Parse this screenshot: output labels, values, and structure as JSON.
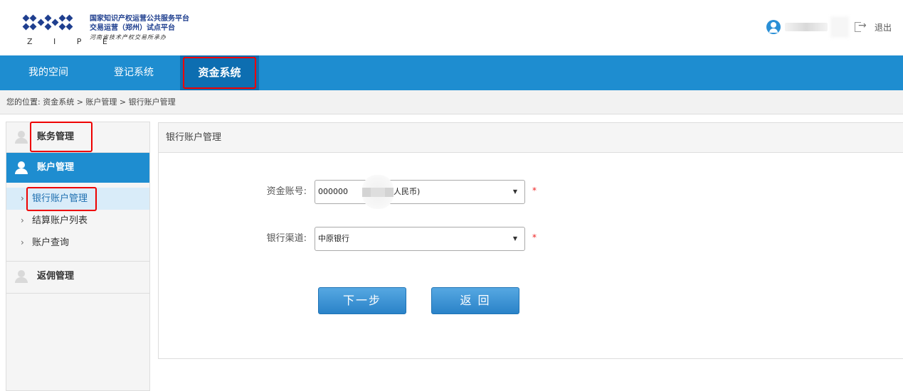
{
  "header": {
    "logo_text": "Z I P E",
    "title_line1": "国家知识产权运营公共服务平台",
    "title_line2": "交易运营（郑州）试点平台",
    "title_line3": "河南省技术产权交易所承办",
    "logout_label": "退出"
  },
  "nav": {
    "items": [
      {
        "label": "我的空间"
      },
      {
        "label": "登记系统"
      },
      {
        "label": "资金系统"
      }
    ]
  },
  "breadcrumb": {
    "text": "您的位置:  资金系统 > 账户管理 > 银行账户管理"
  },
  "sidebar": {
    "sections": [
      {
        "label": "账务管理"
      },
      {
        "label": "账户管理"
      },
      {
        "label": "返佣管理"
      }
    ],
    "items": [
      {
        "label": "银行账户管理"
      },
      {
        "label": "结算账户列表"
      },
      {
        "label": "账户查询"
      }
    ]
  },
  "panel": {
    "title": "银行账户管理",
    "fields": [
      {
        "label": "资金账号:",
        "value_prefix": "000000",
        "value_suffix": "人民币)",
        "required": "*"
      },
      {
        "label": "银行渠道:",
        "value": "中原银行",
        "required": "*"
      }
    ],
    "buttons": {
      "next": "下一步",
      "back": "返 回"
    }
  },
  "colors": {
    "nav_bg": "#1e8dd0",
    "nav_active_bg": "#0d6eb1",
    "button_bg": "#2a82c8",
    "highlight": "#ee0000"
  }
}
